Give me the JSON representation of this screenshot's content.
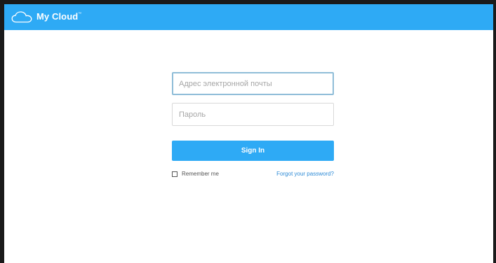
{
  "header": {
    "title": "My Cloud",
    "trademark": "™",
    "logo_icon": "cloud-icon",
    "background": "#2eaaf5"
  },
  "login": {
    "email_placeholder": "Адрес электронной почты",
    "email_value": "",
    "password_placeholder": "Пароль",
    "password_value": "",
    "signin_label": "Sign In",
    "remember_label": "Remember me",
    "remember_checked": false,
    "forgot_label": "Forgot your password?"
  },
  "colors": {
    "accent": "#2eaaf5",
    "link": "#2e8bd6"
  }
}
